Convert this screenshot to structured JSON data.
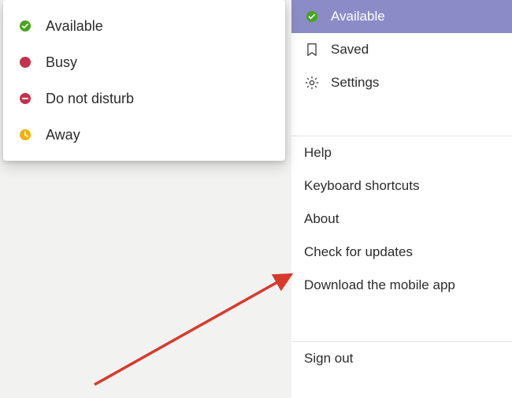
{
  "statusSubmenu": {
    "available": "Available",
    "busy": "Busy",
    "dnd": "Do not disturb",
    "away": "Away"
  },
  "userMenu": {
    "available": "Available",
    "saved": "Saved",
    "settings": "Settings",
    "help": "Help",
    "keyboardShortcuts": "Keyboard shortcuts",
    "about": "About",
    "checkForUpdates": "Check for updates",
    "downloadApp": "Download the mobile app",
    "signOut": "Sign out"
  },
  "colors": {
    "available": "#46a51e",
    "availableCheck": "#ffffff",
    "busy": "#c4314b",
    "dnd": "#c4314b",
    "away": "#f2b20a",
    "selectedBg": "#8b8cc7",
    "arrow": "#d73a2c"
  }
}
